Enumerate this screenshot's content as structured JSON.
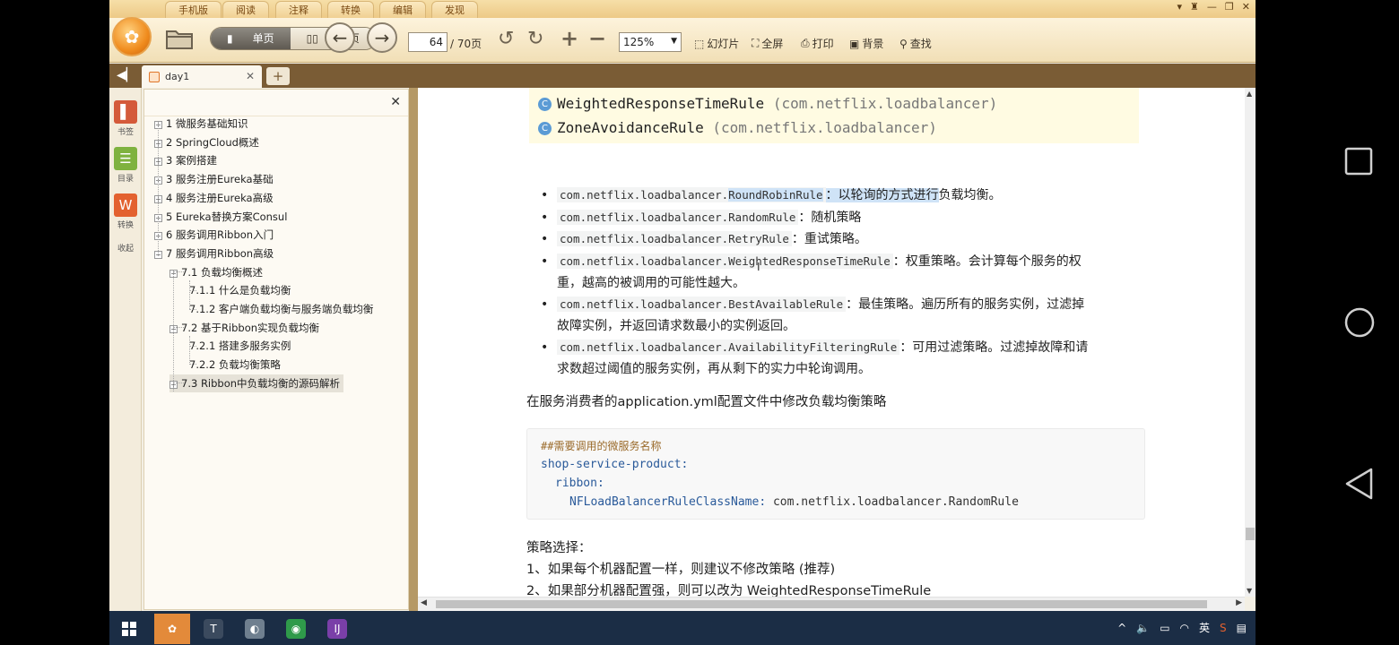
{
  "menu_tabs": [
    "手机版",
    "阅读",
    "注释",
    "转换",
    "编辑",
    "发现"
  ],
  "toolbar": {
    "single_page": "单页",
    "double_page": "双页",
    "current_page": "64",
    "total_pages": "/ 70页",
    "zoom": "125%",
    "slideshow": "幻灯片",
    "fullscreen": "全屏",
    "print": "打印",
    "background": "背景",
    "search": "查找"
  },
  "tab": {
    "title": "day1",
    "new_tab": "+"
  },
  "icon_strip": [
    {
      "label": "书签",
      "color": "#d45a3a",
      "glyph": "▌"
    },
    {
      "label": "目录",
      "color": "#7fb23f",
      "glyph": "☰"
    },
    {
      "label": "转换",
      "color": "#e3612f",
      "glyph": "W"
    },
    {
      "label": "收起",
      "color": "",
      "glyph": ""
    }
  ],
  "outline": {
    "items": [
      {
        "label": "1 微服务基础知识",
        "expander": "+"
      },
      {
        "label": "2 SpringCloud概述",
        "expander": "+"
      },
      {
        "label": "3 案例搭建",
        "expander": "+"
      },
      {
        "label": "3 服务注册Eureka基础",
        "expander": "+"
      },
      {
        "label": "4 服务注册Eureka高级",
        "expander": "+"
      },
      {
        "label": "5 Eureka替换方案Consul",
        "expander": "+"
      },
      {
        "label": "6 服务调用Ribbon入门",
        "expander": "+"
      },
      {
        "label": "7 服务调用Ribbon高级",
        "expander": "−"
      },
      {
        "label": "7.1 负载均衡概述",
        "expander": "−"
      },
      {
        "label": "7.1.1 什么是负载均衡",
        "expander": ""
      },
      {
        "label": "7.1.2 客户端负载均衡与服务端负载均衡",
        "expander": ""
      },
      {
        "label": "7.2 基于Ribbon实现负载均衡",
        "expander": "−"
      },
      {
        "label": "7.2.1 搭建多服务实例",
        "expander": ""
      },
      {
        "label": "7.2.2 负载均衡策略",
        "expander": ""
      },
      {
        "label": "7.3 Ribbon中负载均衡的源码解析",
        "expander": "+"
      }
    ]
  },
  "document": {
    "class_list": [
      {
        "name": "WeightedResponseTimeRule",
        "pkg": "(com.netflix.loadbalancer)"
      },
      {
        "name": "ZoneAvoidanceRule",
        "pkg": "(com.netflix.loadbalancer)"
      }
    ],
    "rules": [
      {
        "pkg": "com.netflix.loadbalancer.",
        "cls": "RoundRobinRule",
        "desc_hl": "：以轮询的方式进行",
        "desc": "负载均衡。",
        "line2": ""
      },
      {
        "pkg": "com.netflix.loadbalancer.",
        "cls": "RandomRule",
        "desc_hl": "",
        "desc": "：随机策略",
        "line2": ""
      },
      {
        "pkg": "com.netflix.loadbalancer.",
        "cls": "RetryRule",
        "desc_hl": "",
        "desc": "：重试策略。",
        "line2": ""
      },
      {
        "pkg": "com.netflix.loadbalancer.",
        "cls": "WeightedResponseTimeRule",
        "desc_hl": "",
        "desc": "：权重策略。会计算每个服务的权",
        "line2": "重，越高的被调用的可能性越大。"
      },
      {
        "pkg": "com.netflix.loadbalancer.",
        "cls": "BestAvailableRule",
        "desc_hl": "",
        "desc": "：最佳策略。遍历所有的服务实例，过滤掉",
        "line2": "故障实例，并返回请求数最小的实例返回。"
      },
      {
        "pkg": "com.netflix.loadbalancer.",
        "cls": "AvailabilityFilteringRule",
        "desc_hl": "",
        "desc": "：可用过滤策略。过滤掉故障和请",
        "line2": "求数超过阈值的服务实例，再从剩下的实力中轮询调用。"
      }
    ],
    "config_intro": "在服务消费者的application.yml配置文件中修改负载均衡策略",
    "code": {
      "comment": "##需要调用的微服务名称",
      "line1_key": "shop-service-product:",
      "line2_key": "ribbon:",
      "line3_key": "NFLoadBalancerRuleClassName:",
      "line3_val": " com.netflix.loadbalancer.RandomRule"
    },
    "strategy_title": "策略选择：",
    "strategy_1": "1、如果每个机器配置一样，则建议不修改策略 (推荐)",
    "strategy_2": "2、如果部分机器配置强，则可以改为 WeightedResponseTimeRule"
  },
  "taskbar": {
    "apps": [
      {
        "name": "reader-app",
        "color": "#e38a3a",
        "glyph": "✿",
        "active": true
      },
      {
        "name": "typora-app",
        "color": "#3b4a5e",
        "glyph": "T",
        "active": false
      },
      {
        "name": "gimp-app",
        "color": "#6f7f8f",
        "glyph": "◐",
        "active": false
      },
      {
        "name": "chrome-app",
        "color": "#2f9a4a",
        "glyph": "◉",
        "active": false
      },
      {
        "name": "intellij-app",
        "color": "#7a3fa8",
        "glyph": "IJ",
        "active": false
      }
    ],
    "tray_lang": "英"
  }
}
